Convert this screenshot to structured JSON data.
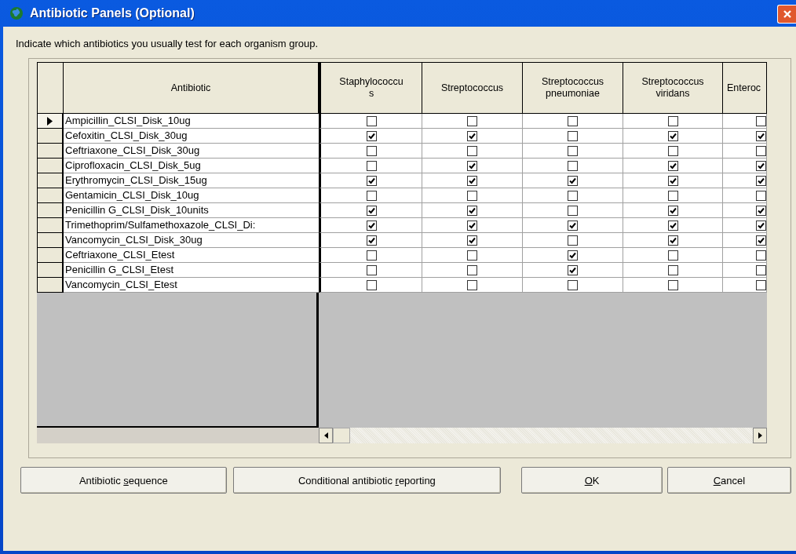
{
  "window": {
    "title": "Antibiotic Panels (Optional)"
  },
  "instruction": "Indicate which antibiotics you usually test for each organism group.",
  "table": {
    "columns": [
      {
        "lines": [
          "Antibiotic"
        ]
      },
      {
        "lines": [
          "Staphylococcu",
          "s"
        ]
      },
      {
        "lines": [
          "Streptococcus"
        ]
      },
      {
        "lines": [
          "Streptococcus",
          "pneumoniae"
        ]
      },
      {
        "lines": [
          "Streptococcus",
          "viridans"
        ]
      },
      {
        "lines": [
          "Enteroc"
        ]
      }
    ],
    "rows": [
      {
        "antibiotic": "Ampicillin_CLSI_Disk_10ug",
        "selected": true,
        "checks": [
          false,
          false,
          false,
          false,
          false
        ]
      },
      {
        "antibiotic": "Cefoxitin_CLSI_Disk_30ug",
        "selected": false,
        "checks": [
          true,
          true,
          false,
          true,
          true
        ]
      },
      {
        "antibiotic": "Ceftriaxone_CLSI_Disk_30ug",
        "selected": false,
        "checks": [
          false,
          false,
          false,
          false,
          false
        ]
      },
      {
        "antibiotic": "Ciprofloxacin_CLSI_Disk_5ug",
        "selected": false,
        "checks": [
          false,
          true,
          false,
          true,
          true
        ]
      },
      {
        "antibiotic": "Erythromycin_CLSI_Disk_15ug",
        "selected": false,
        "checks": [
          true,
          true,
          true,
          true,
          true
        ]
      },
      {
        "antibiotic": "Gentamicin_CLSI_Disk_10ug",
        "selected": false,
        "checks": [
          false,
          false,
          false,
          false,
          false
        ]
      },
      {
        "antibiotic": "Penicillin G_CLSI_Disk_10units",
        "selected": false,
        "checks": [
          true,
          true,
          false,
          true,
          true
        ]
      },
      {
        "antibiotic": "Trimethoprim/Sulfamethoxazole_CLSI_Di:",
        "selected": false,
        "checks": [
          true,
          true,
          true,
          true,
          true
        ]
      },
      {
        "antibiotic": "Vancomycin_CLSI_Disk_30ug",
        "selected": false,
        "checks": [
          true,
          true,
          false,
          true,
          true
        ]
      },
      {
        "antibiotic": "Ceftriaxone_CLSI_Etest",
        "selected": false,
        "checks": [
          false,
          false,
          true,
          false,
          false
        ]
      },
      {
        "antibiotic": "Penicillin G_CLSI_Etest",
        "selected": false,
        "checks": [
          false,
          false,
          true,
          false,
          false
        ]
      },
      {
        "antibiotic": "Vancomycin_CLSI_Etest",
        "selected": false,
        "checks": [
          false,
          false,
          false,
          false,
          false
        ]
      }
    ]
  },
  "buttons": [
    {
      "before": "Antibiotic ",
      "key": "s",
      "after": "equence"
    },
    {
      "before": "Conditional antibiotic ",
      "key": "r",
      "after": "eporting"
    },
    {
      "key": "O",
      "after": "K"
    },
    {
      "key": "C",
      "after": "ancel"
    }
  ]
}
